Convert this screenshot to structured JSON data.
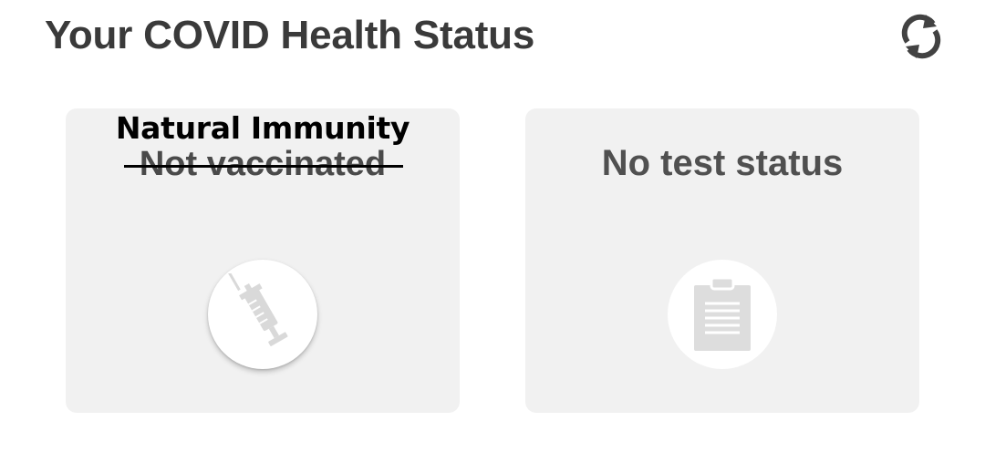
{
  "header": {
    "title": "Your COVID Health Status",
    "refresh_icon": "refresh-icon"
  },
  "vaccination_card": {
    "overlay_label": "Natural Immunity",
    "status": "Not vaccinated",
    "status_struck_through": true,
    "icon": "syringe-icon"
  },
  "test_card": {
    "status": "No test status",
    "icon": "clipboard-icon"
  },
  "colors": {
    "card_background": "#f1f1f1",
    "title_text": "#3a3a3a",
    "status_text": "#505050",
    "icon_fill": "#dddddd"
  }
}
